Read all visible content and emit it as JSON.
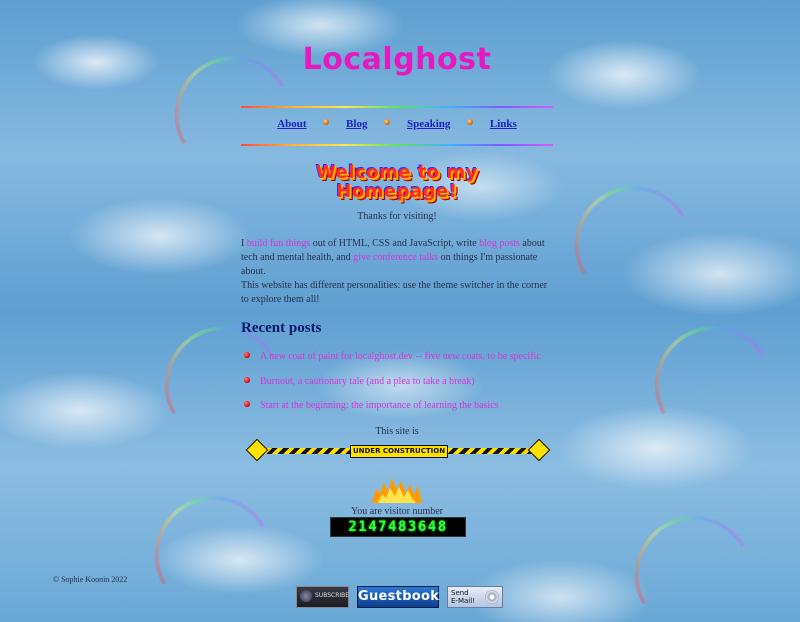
{
  "site_title": "Localghost",
  "nav": {
    "items": [
      "About",
      "Blog",
      "Speaking",
      "Links"
    ]
  },
  "welcome": {
    "line1": "Welcome to my",
    "line2": "Homepage!"
  },
  "thanks": "Thanks for visiting!",
  "intro": {
    "p1_a": "I ",
    "p1_link1": "build fun things",
    "p1_b": " out of HTML, CSS and JavaScript, write ",
    "p1_link2": "blog posts",
    "p1_c": " about tech and mental health, and ",
    "p1_link3": "give conference talks",
    "p1_d": " on things I'm passionate about.",
    "p2": "This website has different personalities: use the theme switcher in the corner to explore them all!"
  },
  "recent_posts": {
    "heading": "Recent posts",
    "items": [
      "A new coat of paint for localghost.dev -- five new coats, to be specific",
      "Burnout, a cautionary tale (and a plea to take a break)",
      "Start at the beginning: the importance of learning the basics"
    ]
  },
  "construction": {
    "intro": "This site is",
    "label": "UNDER CONSTRUCTION"
  },
  "visitor": {
    "text": "You are visitor number",
    "count": "2147483648"
  },
  "footer": {
    "copyright": "© Sophie Koonin 2022"
  },
  "badges": {
    "subscribe": "SUBSCRIBE",
    "guestbook": "Guestbook",
    "email_line1": "Send",
    "email_line2": "E-Mail!"
  },
  "colors": {
    "title": "#e619c1",
    "link": "#d634d8",
    "nav_link": "#1f1fbf",
    "heading": "#0d1a6a",
    "counter": "#2cff39"
  }
}
